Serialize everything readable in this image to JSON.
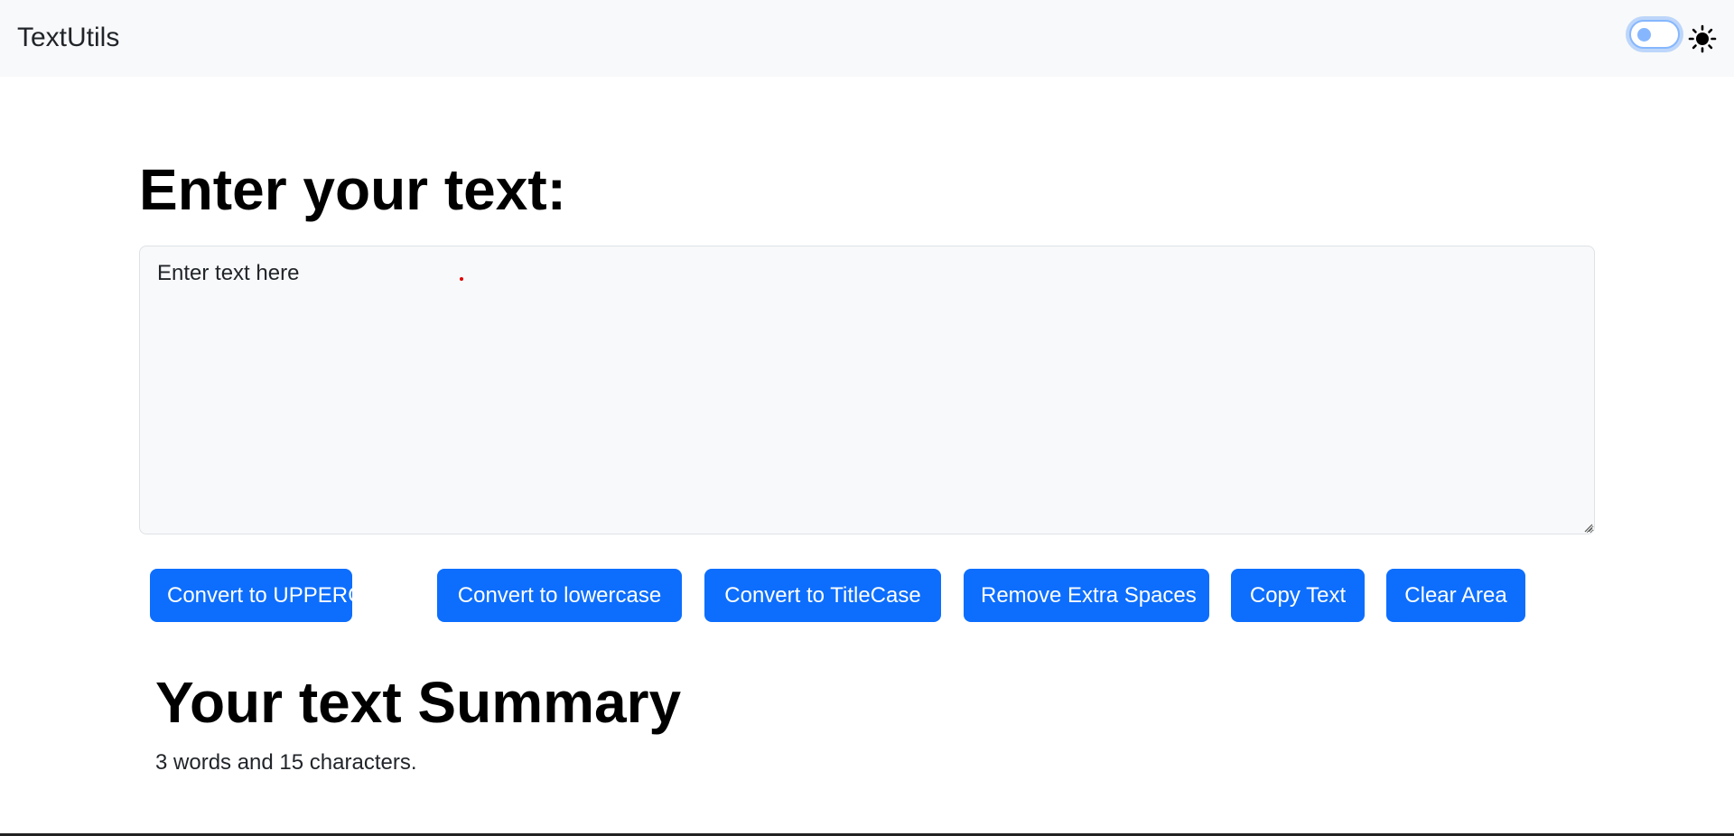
{
  "navbar": {
    "brand": "TextUtils",
    "theme_toggle": {
      "checked": false
    },
    "theme_icon": "sun-icon"
  },
  "main": {
    "heading": "Enter your text:",
    "textarea": {
      "value": "Enter text here",
      "placeholder": ""
    },
    "buttons": [
      {
        "label": "Convert to UPPERCASE"
      },
      {
        "label": "Convert to lowercase"
      },
      {
        "label": "Convert to TitleCase"
      },
      {
        "label": "Remove Extra Spaces"
      },
      {
        "label": "Copy Text"
      },
      {
        "label": "Clear Area"
      }
    ]
  },
  "summary": {
    "heading": "Your text Summary",
    "count_text": "3 words and 15 characters."
  },
  "colors": {
    "primary": "#0d6efd",
    "navbar_bg": "#f8f9fa",
    "textarea_bg": "#f8f9fa"
  }
}
